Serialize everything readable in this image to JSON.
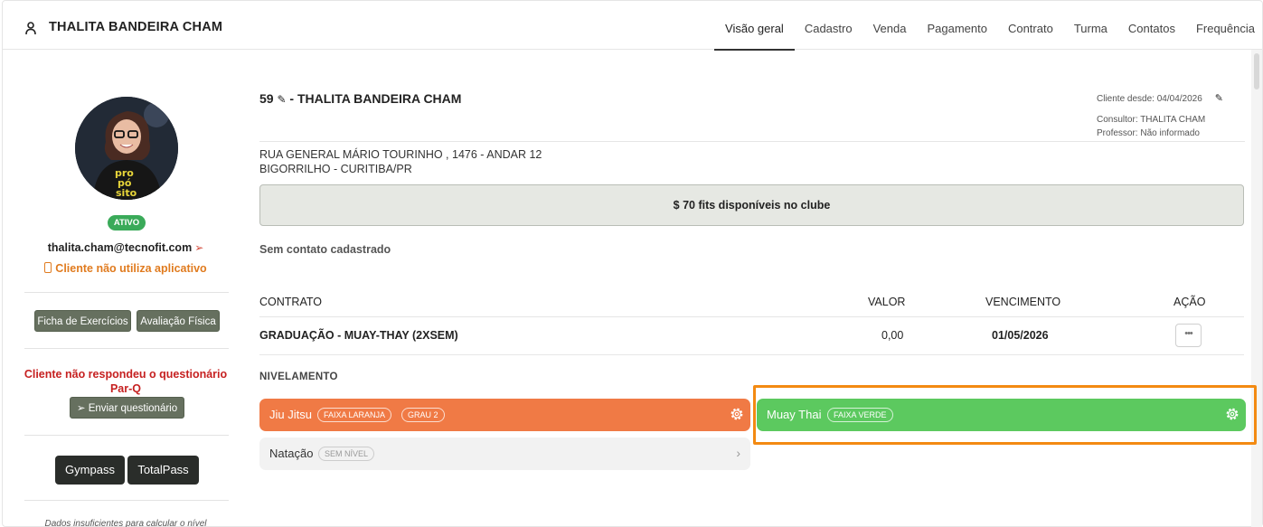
{
  "header": {
    "client_name": "THALITA BANDEIRA CHAM",
    "tabs": [
      {
        "label": "Visão geral",
        "active": true
      },
      {
        "label": "Cadastro"
      },
      {
        "label": "Venda"
      },
      {
        "label": "Pagamento"
      },
      {
        "label": "Contrato"
      },
      {
        "label": "Turma"
      },
      {
        "label": "Contatos"
      },
      {
        "label": "Frequência"
      }
    ]
  },
  "sidebar": {
    "status": "ATIVO",
    "email": "thalita.cham@tecnofit.com",
    "no_app": "Cliente não utiliza aplicativo",
    "buttons": {
      "ficha": "Ficha de Exercícios",
      "avaliacao": "Avaliação Física"
    },
    "parq_line1": "Cliente não respondeu o questionário",
    "parq_line2": "Par-Q",
    "send_questionnaire": "Enviar questionário",
    "gympass": "Gympass",
    "totalpass": "TotalPass",
    "insufficient": "Dados insuficientes para calcular o nível"
  },
  "main": {
    "client_id": "59",
    "client_name": "- THALITA BANDEIRA CHAM",
    "client_since": "Cliente desde: 04/04/2026",
    "consultant": "Consultor: THALITA CHAM",
    "teacher": "Professor: Não informado",
    "address_line1": "RUA GENERAL MÁRIO TOURINHO , 1476 - ANDAR 12",
    "address_line2": "BIGORRILHO - CURITIBA/PR",
    "fits": "$ 70 fits disponíveis no clube",
    "no_contact": "Sem contato cadastrado",
    "table": {
      "headers": {
        "contract": "CONTRATO",
        "value": "VALOR",
        "due": "VENCIMENTO",
        "action": "AÇÃO"
      },
      "rows": [
        {
          "contract": "GRADUAÇÃO - MUAY-THAY (2XSEM)",
          "value": "0,00",
          "due": "01/05/2026",
          "action_label": "•••"
        }
      ]
    },
    "leveling": {
      "title": "NIVELAMENTO",
      "items": [
        {
          "modality": "Jiu Jitsu",
          "belt": "FAIXA LARANJA",
          "degree": "GRAU 2",
          "color": "#f07a45"
        },
        {
          "modality": "Muay Thai",
          "belt": "FAIXA VERDE",
          "color": "#5cc95f"
        },
        {
          "modality": "Natação",
          "belt": "SEM NÍVEL",
          "color": "#f2f2f2"
        }
      ]
    }
  },
  "colors": {
    "active_badge": "#3aaa59",
    "warning": "#e07b1f",
    "error": "#c62121",
    "highlight": "#f38a12"
  }
}
